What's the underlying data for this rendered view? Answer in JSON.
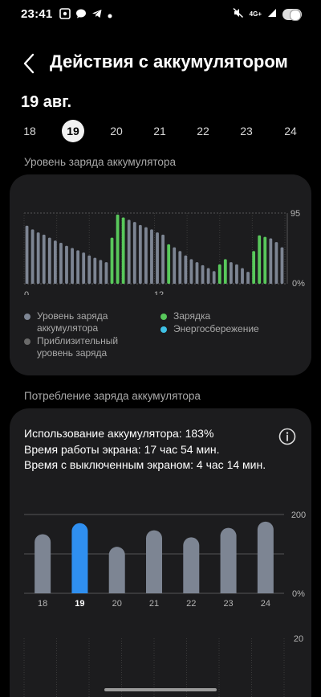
{
  "status_bar": {
    "time": "23:41",
    "left_icons": [
      "screen-record-icon",
      "message-icon",
      "telegram-icon",
      "dot-icon"
    ],
    "right_icons": [
      "mute-icon",
      "4g-icon",
      "signal-icon",
      "battery-toggle-icon"
    ],
    "network": "4G+"
  },
  "header": {
    "title": "Действия с аккумулятором"
  },
  "date_title": "19 авг.",
  "days": [
    {
      "label": "18",
      "selected": false
    },
    {
      "label": "19",
      "selected": true
    },
    {
      "label": "20",
      "selected": false
    },
    {
      "label": "21",
      "selected": false
    },
    {
      "label": "22",
      "selected": false
    },
    {
      "label": "23",
      "selected": false
    },
    {
      "label": "24",
      "selected": false
    }
  ],
  "level_section": {
    "title": "Уровень заряда аккумулятора",
    "legend": {
      "level": "Уровень заряда аккумулятора",
      "estimated": "Приблизительный уровень заряда",
      "charging": "Зарядка",
      "power_saving": "Энергосбережение"
    }
  },
  "usage_section": {
    "title": "Потребление заряда аккумулятора",
    "usage": "Использование аккумулятора: 183%",
    "screen_on": "Время работы экрана: 17 час 54 мин.",
    "screen_off": "Время с выключенным экраном: 4 час 14 мин."
  },
  "colors": {
    "level_bar": "#7d8593",
    "charging_bar": "#58c85b",
    "power_saving": "#3fc1e6",
    "estimated": "#6a6a6a",
    "selected_bar": "#2f8ff0",
    "card": "#1c1c1e"
  },
  "chart_data": [
    {
      "type": "bar",
      "title": "Уровень заряда аккумулятора",
      "x_tick_labels": [
        "0",
        "12"
      ],
      "y_tick_labels": [
        "95",
        "0%"
      ],
      "ylim": [
        0,
        95
      ],
      "hours": 48,
      "values": [
        78,
        73,
        69,
        66,
        62,
        58,
        55,
        51,
        48,
        45,
        42,
        38,
        35,
        32,
        29,
        62,
        93,
        89,
        86,
        83,
        79,
        76,
        73,
        69,
        66,
        53,
        49,
        44,
        38,
        33,
        29,
        25,
        21,
        17,
        26,
        33,
        29,
        26,
        21,
        16,
        44,
        65,
        63,
        61,
        56,
        49
      ],
      "charging": [
        false,
        false,
        false,
        false,
        false,
        false,
        false,
        false,
        false,
        false,
        false,
        false,
        false,
        false,
        false,
        true,
        true,
        true,
        false,
        false,
        false,
        false,
        false,
        false,
        false,
        true,
        false,
        false,
        false,
        false,
        false,
        false,
        false,
        false,
        true,
        true,
        false,
        false,
        false,
        false,
        true,
        true,
        true,
        false,
        false,
        false
      ],
      "grid": true
    },
    {
      "type": "bar",
      "title": "Потребление заряда аккумулятора",
      "categories": [
        "18",
        "19",
        "20",
        "21",
        "22",
        "23",
        "24"
      ],
      "values": [
        150,
        178,
        118,
        160,
        142,
        166,
        182
      ],
      "selected": "19",
      "y_tick_labels": [
        "200",
        "0%"
      ],
      "ylim": [
        0,
        200
      ],
      "grid": true
    },
    {
      "type": "bar",
      "y_tick_labels": [
        "20"
      ],
      "values": []
    }
  ]
}
